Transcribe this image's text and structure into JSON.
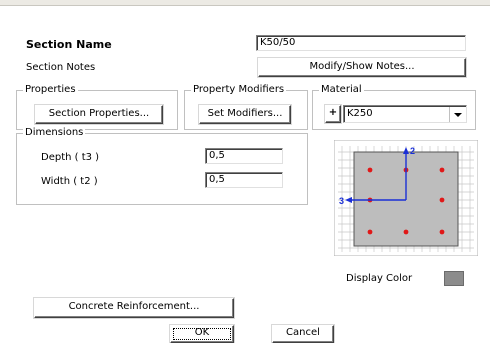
{
  "section_name": {
    "label": "Section Name",
    "value": "K50/50"
  },
  "section_notes": {
    "label": "Section Notes",
    "button": "Modify/Show Notes..."
  },
  "properties": {
    "title": "Properties",
    "button": "Section Properties..."
  },
  "property_modifiers": {
    "title": "Property Modifiers",
    "button": "Set Modifiers..."
  },
  "material": {
    "title": "Material",
    "plus": "+",
    "selected": "K250"
  },
  "dimensions": {
    "title": "Dimensions",
    "depth": {
      "label": "Depth  ( t3 )",
      "value": "0,5"
    },
    "width": {
      "label": "Width  ( t2 )",
      "value": "0,5"
    }
  },
  "preview": {
    "axis2": "2",
    "axis3": "3",
    "rebar_color": "#e01818",
    "axis_color": "#1a2fd6",
    "section_fill": "#bdbdbd"
  },
  "display_color": {
    "label": "Display Color",
    "color": "#8c8c8c"
  },
  "concrete_reinforcement": {
    "button": "Concrete Reinforcement..."
  },
  "buttons": {
    "ok": "OK",
    "cancel": "Cancel"
  }
}
